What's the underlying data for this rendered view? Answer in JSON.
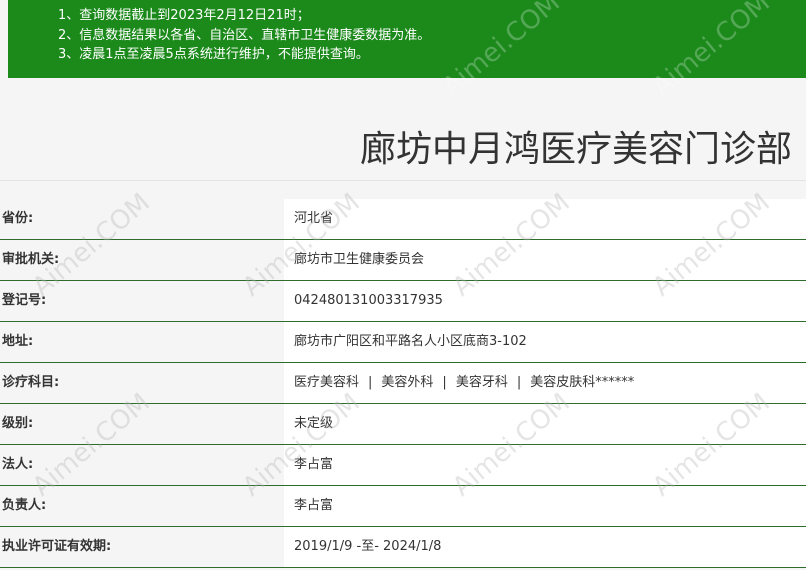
{
  "notice": {
    "lines": [
      "1、查询数据截止到2023年2月12日21时；",
      "2、信息数据结果以各省、自治区、直辖市卫生健康委数据为准。",
      "3、凌晨1点至凌晨5点系统进行维护，不能提供查询。"
    ]
  },
  "title": "廊坊中月鸿医疗美容门诊部",
  "rows": [
    {
      "label": "省份:",
      "value": "河北省"
    },
    {
      "label": "审批机关:",
      "value": "廊坊市卫生健康委员会"
    },
    {
      "label": "登记号:",
      "value": "042480131003317935"
    },
    {
      "label": "地址:",
      "value": "廊坊市广阳区和平路名人小区底商3-102"
    },
    {
      "label": "诊疗科目:",
      "departments": [
        "医疗美容科",
        "美容外科",
        "美容牙科",
        "美容皮肤科******"
      ],
      "separator": "|"
    },
    {
      "label": "级别:",
      "value": "未定级"
    },
    {
      "label": "法人:",
      "value": "李占富"
    },
    {
      "label": "负责人:",
      "value": "李占富"
    },
    {
      "label": "执业许可证有效期:",
      "value": "2019/1/9 -至- 2024/1/8"
    }
  ],
  "watermark": "Aimei.COM",
  "colors": {
    "notice_bg": "#1b8a1b",
    "row_border": "#2d6e2d"
  }
}
